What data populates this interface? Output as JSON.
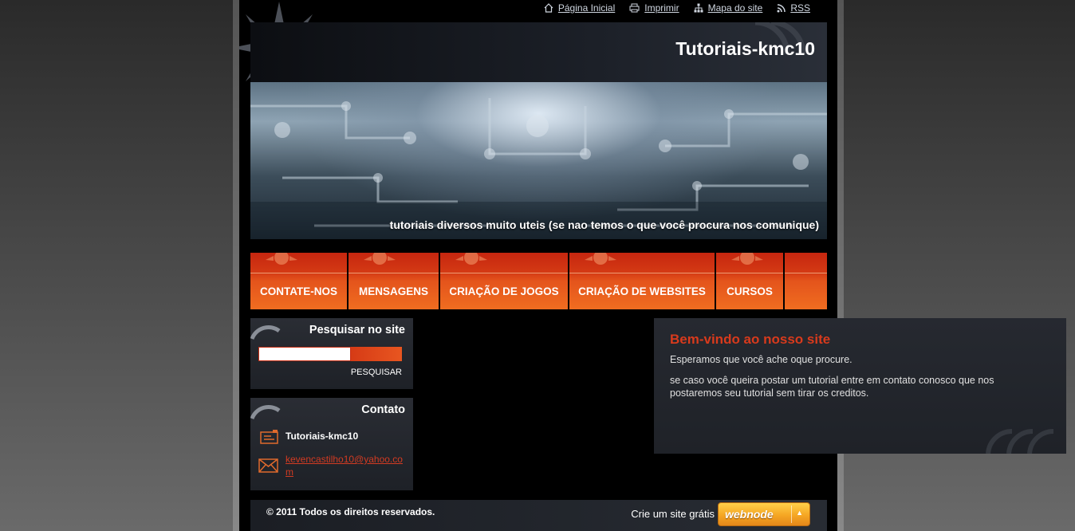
{
  "toplinks": {
    "home": "Página Inicial",
    "print": "Imprimir",
    "sitemap": "Mapa do site",
    "rss": "RSS"
  },
  "header": {
    "title": "Tutoriais-kmc10",
    "tagline": "tutoriais diversos muito uteis (se nao temos o que você procura nos comunique)"
  },
  "nav": {
    "items": [
      {
        "label": "CONTATE-NOS"
      },
      {
        "label": "MENSAGENS"
      },
      {
        "label": "CRIAÇÃO DE JOGOS"
      },
      {
        "label": "CRIAÇÃO DE WEBSITES"
      },
      {
        "label": "CURSOS"
      }
    ]
  },
  "search": {
    "title": "Pesquisar no site",
    "value": "",
    "button": "PESQUISAR"
  },
  "contact": {
    "title": "Contato",
    "name": "Tutoriais-kmc10",
    "email": "kevencastilho10@yahoo.com"
  },
  "main": {
    "heading": "Bem-vindo ao nosso site",
    "p1": "Esperamos que você ache oque procure.",
    "p2": "se caso você queira postar um tutorial entre em contato conosco que nos postaremos seu tutorial sem tirar os creditos."
  },
  "footer": {
    "copyright": "© 2011 Todos os direitos reservados.",
    "create_site": "Crie um site grátis",
    "webnode": "webnode"
  },
  "colors": {
    "accent": "#d83a1c",
    "nav_top": "#c6260f",
    "nav_bottom": "#f06d20",
    "link": "#cfd6e0"
  }
}
